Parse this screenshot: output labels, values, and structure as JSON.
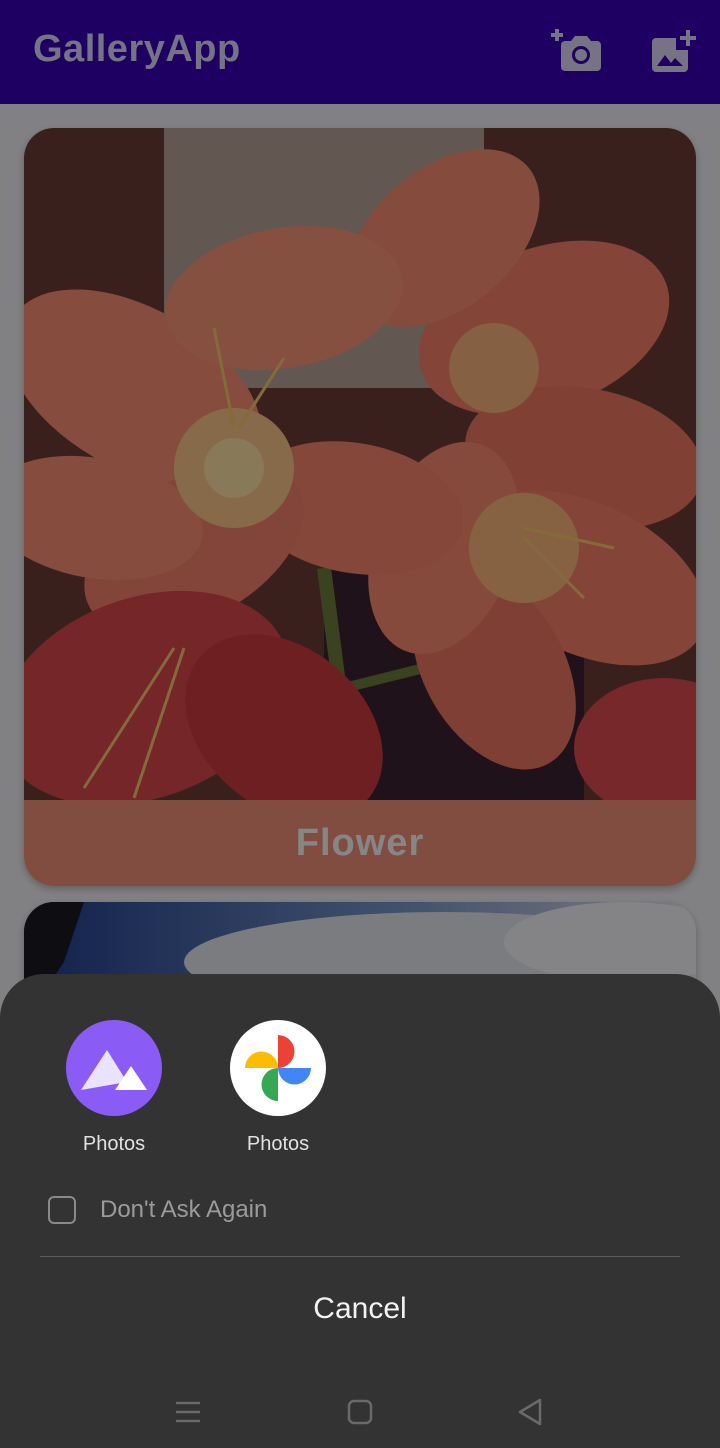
{
  "app_bar": {
    "title": "GalleryApp",
    "camera_icon": "add-photo-camera-icon",
    "gallery_icon": "add-image-icon",
    "color": "#3700b3"
  },
  "gallery": {
    "cards": [
      {
        "caption": "Flower",
        "caption_color": "#e98d76"
      },
      {
        "caption": ""
      }
    ]
  },
  "chooser_sheet": {
    "apps": [
      {
        "label": "Photos",
        "icon": "photos-mountains-icon"
      },
      {
        "label": "Photos",
        "icon": "google-photos-pinwheel-icon"
      }
    ],
    "dont_ask_label": "Don't Ask Again",
    "dont_ask_checked": false,
    "cancel_label": "Cancel"
  },
  "nav_bar": {
    "buttons": [
      "menu-icon",
      "home-icon",
      "back-icon"
    ]
  }
}
